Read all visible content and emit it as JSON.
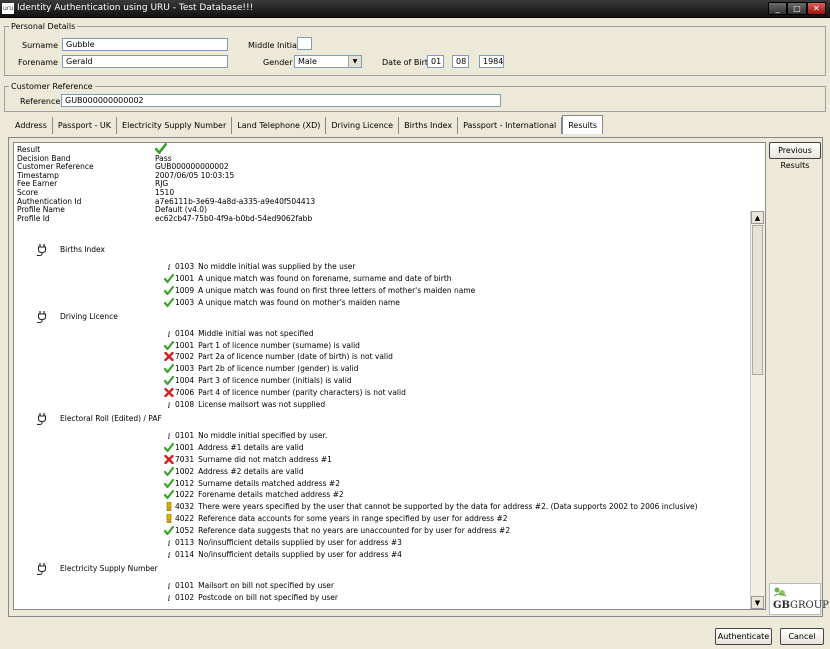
{
  "window": {
    "title": "Identity Authentication using URU - Test Database!!!",
    "app_icon": "uru"
  },
  "personal": {
    "legend": "Personal Details",
    "surname_label": "Surname",
    "surname": "Gubble",
    "forename_label": "Forename",
    "forename": "Gerald",
    "middle_initial_label": "Middle Initial",
    "middle_initial": "",
    "gender_label": "Gender",
    "gender": "Male",
    "dob_label": "Date of Birth",
    "dob_day": "01",
    "dob_month": "08",
    "dob_year": "1984"
  },
  "customer": {
    "legend": "Customer Reference",
    "reference_label": "Reference",
    "reference": "GUB000000000002"
  },
  "tabs": [
    {
      "label": "Address"
    },
    {
      "label": "Passport - UK"
    },
    {
      "label": "Electricity Supply Number"
    },
    {
      "label": "Land Telephone (XD)"
    },
    {
      "label": "Driving Licence"
    },
    {
      "label": "Births Index"
    },
    {
      "label": "Passport - International"
    },
    {
      "label": "Results",
      "active": true
    }
  ],
  "summary": [
    {
      "key": "Result",
      "value": "",
      "icon": "check"
    },
    {
      "key": "Decision Band",
      "value": "Pass"
    },
    {
      "key": "Customer Reference",
      "value": "GUB000000000002"
    },
    {
      "key": "Timestamp",
      "value": "2007/06/05 10:03:15"
    },
    {
      "key": "Fee Earner",
      "value": "RJG"
    },
    {
      "key": "Score",
      "value": "1510"
    },
    {
      "key": "Authentication Id",
      "value": "a7e6111b-3e69-4a8d-a335-a9e40f504413"
    },
    {
      "key": "Profile Name",
      "value": "Default (v4.0)"
    },
    {
      "key": "Profile Id",
      "value": "ec62cb47-75b0-4f9a-b0bd-54ed9062fabb"
    }
  ],
  "sections": [
    {
      "name": "Births Index",
      "items": [
        {
          "icon": "info",
          "code": "0103",
          "text": "No middle initial was supplied by the user"
        },
        {
          "icon": "check",
          "code": "1001",
          "text": "A unique match was found on forename, surname and date of birth"
        },
        {
          "icon": "check",
          "code": "1009",
          "text": "A unique match was found on first three letters of mother's maiden name"
        },
        {
          "icon": "check",
          "code": "1003",
          "text": "A unique match was found on mother's maiden name"
        }
      ]
    },
    {
      "name": "Driving Licence",
      "items": [
        {
          "icon": "info",
          "code": "0104",
          "text": "Middle initial was not specified"
        },
        {
          "icon": "check",
          "code": "1001",
          "text": "Part 1 of licence number (surname) is valid"
        },
        {
          "icon": "cross",
          "code": "7002",
          "text": "Part 2a of licence number (date of birth) is not valid"
        },
        {
          "icon": "check",
          "code": "1003",
          "text": "Part 2b of licence number (gender) is valid"
        },
        {
          "icon": "check",
          "code": "1004",
          "text": "Part 3 of licence number (initials) is valid"
        },
        {
          "icon": "cross",
          "code": "7006",
          "text": "Part 4 of licence number (parity characters) is not valid"
        },
        {
          "icon": "info",
          "code": "0108",
          "text": "License mailsort was not supplied"
        }
      ]
    },
    {
      "name": "Electoral Roll (Edited) / PAF",
      "items": [
        {
          "icon": "info",
          "code": "0101",
          "text": "No middle initial specified by user."
        },
        {
          "icon": "check",
          "code": "1001",
          "text": "Address #1 details are valid"
        },
        {
          "icon": "cross",
          "code": "7031",
          "text": "Surname did not match address #1"
        },
        {
          "icon": "check",
          "code": "1002",
          "text": "Address #2 details are valid"
        },
        {
          "icon": "check",
          "code": "1012",
          "text": "Surname details matched address #2"
        },
        {
          "icon": "check",
          "code": "1022",
          "text": "Forename details matched address #2"
        },
        {
          "icon": "warning",
          "code": "4032",
          "text": "There were years specified by the user that cannot be supported by the data for address #2. (Data supports 2002 to 2006 inclusive)"
        },
        {
          "icon": "warning",
          "code": "4022",
          "text": "Reference data accounts for some years in range specified by user for address #2"
        },
        {
          "icon": "check",
          "code": "1052",
          "text": "Reference data suggests that no years are unaccounted for by user for address #2"
        },
        {
          "icon": "info",
          "code": "0113",
          "text": "No/insufficient details supplied by user for address #3"
        },
        {
          "icon": "info",
          "code": "0114",
          "text": "No/insufficient details supplied by user for address #4"
        }
      ]
    },
    {
      "name": "Electricity Supply Number",
      "items": [
        {
          "icon": "info",
          "code": "0101",
          "text": "Mailsort on bill not specified by user"
        },
        {
          "icon": "info",
          "code": "0102",
          "text": "Postcode on bill not specified by user"
        }
      ]
    }
  ],
  "buttons": {
    "previous_results": "Previous Results",
    "authenticate": "Authenticate",
    "cancel": "Cancel"
  },
  "logo": {
    "brand": "GB",
    "brand_suffix": "GROUP"
  },
  "colors": {
    "check": "#3aa52a",
    "cross": "#d42020",
    "warning": "#e0b000",
    "titlebar": "#1a1a1a"
  }
}
